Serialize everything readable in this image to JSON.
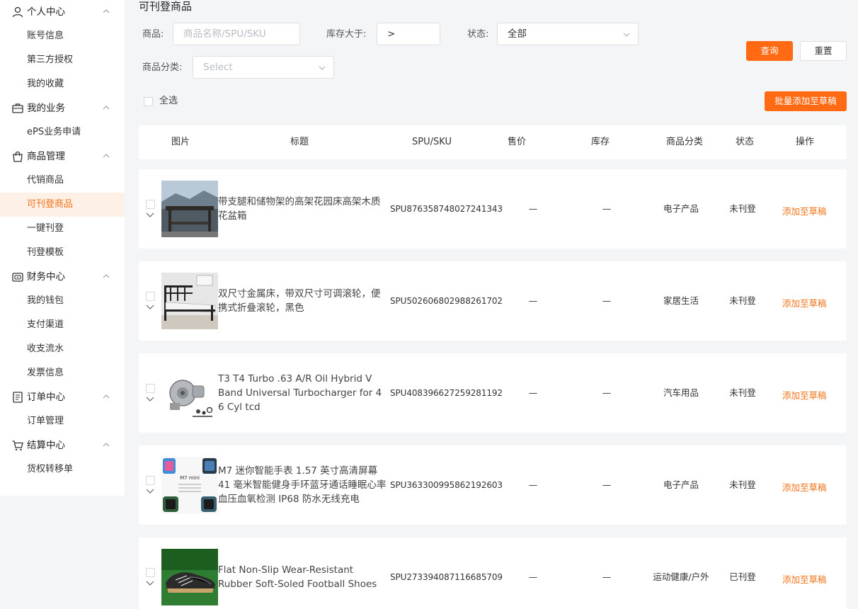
{
  "sidebar": {
    "groups": [
      {
        "label": "个人中心",
        "icon": "user-icon",
        "items": [
          "账号信息",
          "第三方授权",
          "我的收藏"
        ]
      },
      {
        "label": "我的业务",
        "icon": "briefcase-icon",
        "items": [
          "ePS业务申请"
        ]
      },
      {
        "label": "商品管理",
        "icon": "shopping-bag-icon",
        "items": [
          "代销商品",
          "可刊登商品",
          "一键刊登",
          "刊登模板"
        ]
      },
      {
        "label": "财务中心",
        "icon": "wallet-icon",
        "items": [
          "我的钱包",
          "支付渠道",
          "收支流水",
          "发票信息"
        ]
      },
      {
        "label": "订单中心",
        "icon": "order-icon",
        "items": [
          "订单管理"
        ]
      },
      {
        "label": "结算中心",
        "icon": "cart-icon",
        "items": [
          "货权转移单"
        ]
      }
    ],
    "active_item": "可刊登商品"
  },
  "page": {
    "title": "可刊登商品"
  },
  "filters": {
    "product_label": "商品:",
    "product_placeholder": "商品名称/SPU/SKU",
    "stock_label": "库存大于:",
    "stock_value": ">",
    "status_label": "状态:",
    "status_value": "全部",
    "category_label": "商品分类:",
    "category_placeholder": "Select",
    "query_button": "查询",
    "reset_button": "重置"
  },
  "toolbar": {
    "select_all_label": "全选",
    "batch_add_button": "批量添加至草稿"
  },
  "table": {
    "columns": [
      "图片",
      "标题",
      "SPU/SKU",
      "售价",
      "库存",
      "商品分类",
      "状态",
      "操作"
    ],
    "rows": [
      {
        "title": "带支腿和储物架的高架花园床高架木质花盆箱",
        "spu": "SPU876358748027241343",
        "price": "—",
        "stock": "—",
        "category": "电子产品",
        "status": "未刊登",
        "action": "添加至草稿",
        "thumb": "garden"
      },
      {
        "title": "双尺寸金属床，带双尺寸可调滚轮，便携式折叠滚轮，黑色",
        "spu": "SPU502606802988261702",
        "price": "—",
        "stock": "—",
        "category": "家居生活",
        "status": "未刊登",
        "action": "添加至草稿",
        "thumb": "bed"
      },
      {
        "title": "T3 T4 Turbo .63 A/R Oil Hybrid V Band Universal Turbocharger for 4 6 Cyl tcd",
        "spu": "SPU408396627259281192",
        "price": "—",
        "stock": "—",
        "category": "汽车用品",
        "status": "未刊登",
        "action": "添加至草稿",
        "thumb": "turbo"
      },
      {
        "title": "M7 迷你智能手表 1.57 英寸高清屏幕 41 毫米智能健身手环蓝牙通话睡眠心率血压血氧检测 IP68 防水无线充电",
        "spu": "SPU363300995862192603",
        "price": "—",
        "stock": "—",
        "category": "电子产品",
        "status": "未刊登",
        "action": "添加至草稿",
        "thumb": "watch",
        "thumb_text": "M7 mini"
      },
      {
        "title": "Flat Non-Slip Wear-Resistant Rubber Soft-Soled Football Shoes",
        "spu": "SPU273394087116685709",
        "price": "—",
        "stock": "—",
        "category": "运动健康/户外",
        "status": "已刊登",
        "action": "添加至草稿",
        "thumb": "shoe"
      }
    ]
  },
  "colors": {
    "accent": "#ff6a12",
    "accent_text": "#f07318",
    "active_bg": "#fdf0e6",
    "page_bg": "#f4f5f7"
  }
}
